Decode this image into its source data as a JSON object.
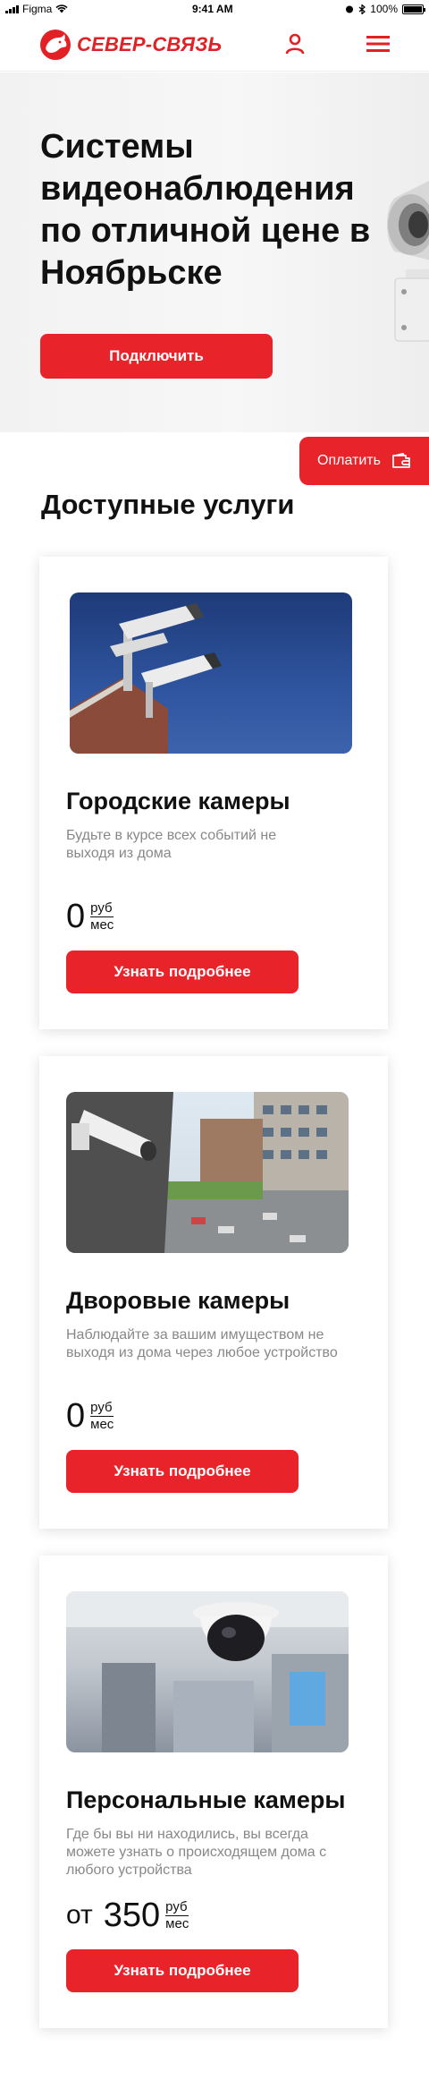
{
  "status_bar": {
    "carrier": "Figma",
    "time": "9:41 AM",
    "battery": "100%"
  },
  "header": {
    "brand": "СЕВЕР-СВЯЗЬ",
    "brand_color": "#e22125",
    "user_icon": "user-icon",
    "menu_icon": "hamburger-menu-icon"
  },
  "hero": {
    "title": "Системы видеонаблюдения по отличной цене в Ноябрьске",
    "cta_label": "Подключить"
  },
  "pay_button": {
    "label": "Оплатить",
    "icon": "wallet-icon"
  },
  "services": {
    "title": "Доступные услуги",
    "cards": [
      {
        "title": "Городские камеры",
        "description": "Будьте в курсе всех событий не выходя из дома",
        "price_prefix": "",
        "price": "0",
        "unit_top": "руб",
        "unit_bottom": "мес",
        "button_label": "Узнать подробнее",
        "image": "city-cameras-photo"
      },
      {
        "title": "Дворовые камеры",
        "description": "Наблюдайте за вашим имуществом не выходя из дома через любое устройство",
        "price_prefix": "",
        "price": "0",
        "unit_top": "руб",
        "unit_bottom": "мес",
        "button_label": "Узнать подробнее",
        "image": "yard-camera-photo"
      },
      {
        "title": "Персональные камеры",
        "description": "Где бы вы ни находились, вы всегда можете узнать о происходящем дома с любого устройства",
        "price_prefix": "от",
        "price": "350",
        "unit_top": "руб",
        "unit_bottom": "мес",
        "button_label": "Узнать подробнее",
        "image": "dome-camera-photo"
      }
    ]
  },
  "colors": {
    "accent": "#e8232a",
    "text": "#111111",
    "muted": "#888888"
  }
}
